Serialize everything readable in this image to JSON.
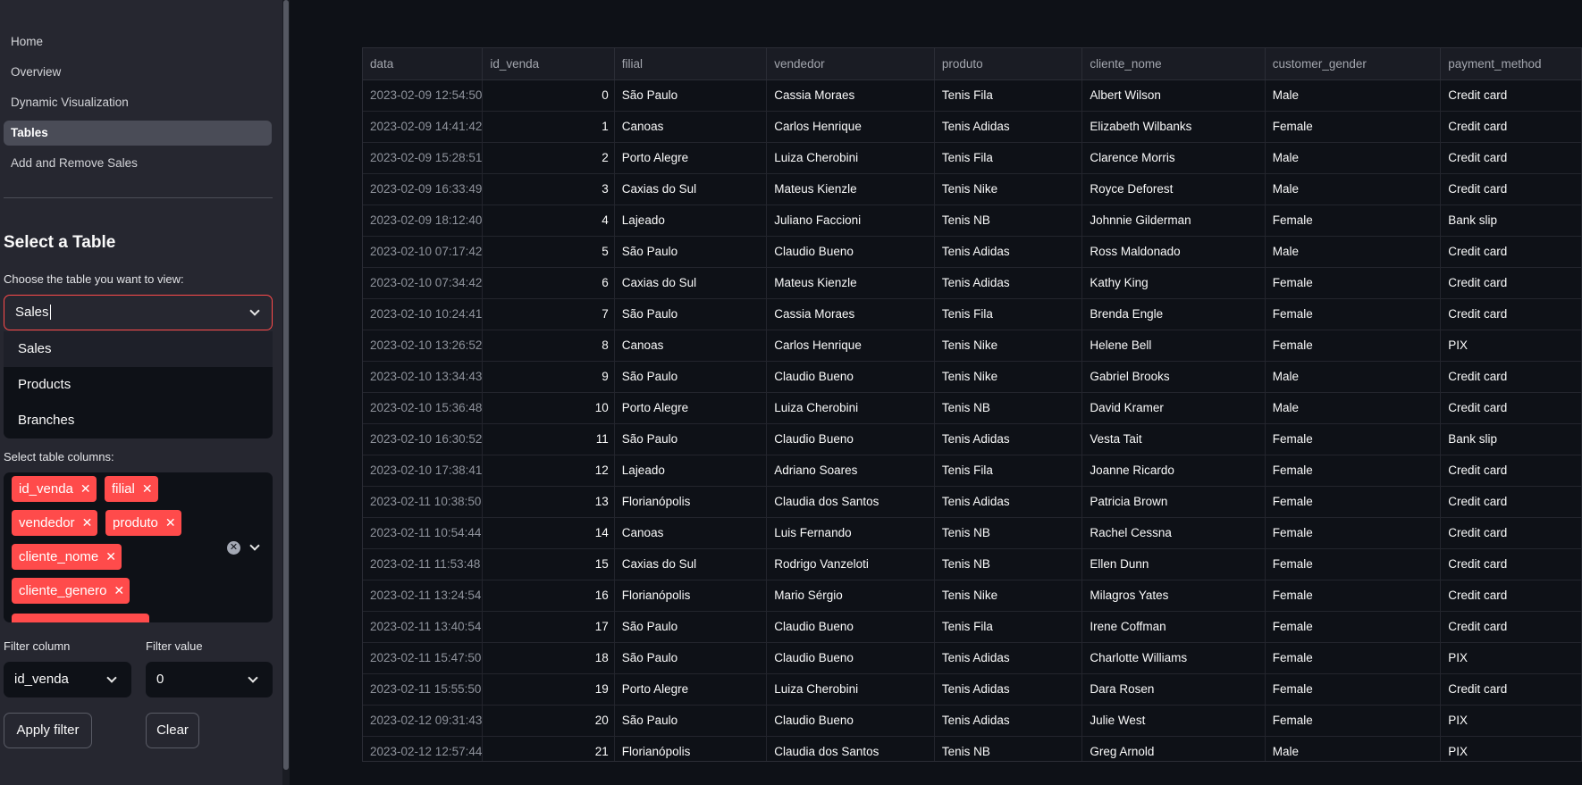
{
  "sidebar": {
    "nav": [
      "Home",
      "Overview",
      "Dynamic Visualization",
      "Tables",
      "Add and Remove Sales"
    ],
    "active_nav": "Tables",
    "section_title": "Select a Table",
    "table_select_label": "Choose the table you want to view:",
    "table_select_value": "Sales",
    "table_options": [
      "Sales",
      "Products",
      "Branches"
    ],
    "columns_label": "Select table columns:",
    "selected_columns": [
      "id_venda",
      "filial",
      "vendedor",
      "produto",
      "cliente_nome",
      "cliente_genero"
    ],
    "filter_column_label": "Filter column",
    "filter_column_value": "id_venda",
    "filter_value_label": "Filter value",
    "filter_value_value": "0",
    "apply_button": "Apply filter",
    "clear_button": "Clear"
  },
  "table": {
    "columns": [
      "data",
      "id_venda",
      "filial",
      "vendedor",
      "produto",
      "cliente_nome",
      "customer_gender",
      "payment_method"
    ],
    "rows": [
      [
        "2023-02-09 12:54:50",
        "0",
        "São Paulo",
        "Cassia Moraes",
        "Tenis Fila",
        "Albert Wilson",
        "Male",
        "Credit card"
      ],
      [
        "2023-02-09 14:41:42",
        "1",
        "Canoas",
        "Carlos Henrique",
        "Tenis Adidas",
        "Elizabeth Wilbanks",
        "Female",
        "Credit card"
      ],
      [
        "2023-02-09 15:28:51",
        "2",
        "Porto Alegre",
        "Luiza Cherobini",
        "Tenis Fila",
        "Clarence Morris",
        "Male",
        "Credit card"
      ],
      [
        "2023-02-09 16:33:49",
        "3",
        "Caxias do Sul",
        "Mateus Kienzle",
        "Tenis Nike",
        "Royce Deforest",
        "Male",
        "Credit card"
      ],
      [
        "2023-02-09 18:12:40",
        "4",
        "Lajeado",
        "Juliano Faccioni",
        "Tenis NB",
        "Johnnie Gilderman",
        "Female",
        "Bank slip"
      ],
      [
        "2023-02-10 07:17:42",
        "5",
        "São Paulo",
        "Claudio Bueno",
        "Tenis Adidas",
        "Ross Maldonado",
        "Male",
        "Credit card"
      ],
      [
        "2023-02-10 07:34:42",
        "6",
        "Caxias do Sul",
        "Mateus Kienzle",
        "Tenis Adidas",
        "Kathy King",
        "Female",
        "Credit card"
      ],
      [
        "2023-02-10 10:24:41",
        "7",
        "São Paulo",
        "Cassia Moraes",
        "Tenis Fila",
        "Brenda Engle",
        "Female",
        "Credit card"
      ],
      [
        "2023-02-10 13:26:52",
        "8",
        "Canoas",
        "Carlos Henrique",
        "Tenis Nike",
        "Helene Bell",
        "Female",
        "PIX"
      ],
      [
        "2023-02-10 13:34:43",
        "9",
        "São Paulo",
        "Claudio Bueno",
        "Tenis Nike",
        "Gabriel Brooks",
        "Male",
        "Credit card"
      ],
      [
        "2023-02-10 15:36:48",
        "10",
        "Porto Alegre",
        "Luiza Cherobini",
        "Tenis NB",
        "David Kramer",
        "Male",
        "Credit card"
      ],
      [
        "2023-02-10 16:30:52",
        "11",
        "São Paulo",
        "Claudio Bueno",
        "Tenis Adidas",
        "Vesta Tait",
        "Female",
        "Bank slip"
      ],
      [
        "2023-02-10 17:38:41",
        "12",
        "Lajeado",
        "Adriano Soares",
        "Tenis Fila",
        "Joanne Ricardo",
        "Female",
        "Credit card"
      ],
      [
        "2023-02-11 10:38:50",
        "13",
        "Florianópolis",
        "Claudia dos Santos",
        "Tenis Adidas",
        "Patricia Brown",
        "Female",
        "Credit card"
      ],
      [
        "2023-02-11 10:54:44",
        "14",
        "Canoas",
        "Luis Fernando",
        "Tenis NB",
        "Rachel Cessna",
        "Female",
        "Credit card"
      ],
      [
        "2023-02-11 11:53:48",
        "15",
        "Caxias do Sul",
        "Rodrigo Vanzeloti",
        "Tenis NB",
        "Ellen Dunn",
        "Female",
        "Credit card"
      ],
      [
        "2023-02-11 13:24:54",
        "16",
        "Florianópolis",
        "Mario Sérgio",
        "Tenis Nike",
        "Milagros Yates",
        "Female",
        "Credit card"
      ],
      [
        "2023-02-11 13:40:54",
        "17",
        "São Paulo",
        "Claudio Bueno",
        "Tenis Fila",
        "Irene Coffman",
        "Female",
        "Credit card"
      ],
      [
        "2023-02-11 15:47:50",
        "18",
        "São Paulo",
        "Claudio Bueno",
        "Tenis Adidas",
        "Charlotte Williams",
        "Female",
        "PIX"
      ],
      [
        "2023-02-11 15:55:50",
        "19",
        "Porto Alegre",
        "Luiza Cherobini",
        "Tenis Adidas",
        "Dara Rosen",
        "Female",
        "Credit card"
      ],
      [
        "2023-02-12 09:31:43",
        "20",
        "São Paulo",
        "Claudio Bueno",
        "Tenis Adidas",
        "Julie West",
        "Female",
        "PIX"
      ],
      [
        "2023-02-12 12:57:44",
        "21",
        "Florianópolis",
        "Claudia dos Santos",
        "Tenis NB",
        "Greg Arnold",
        "Male",
        "PIX"
      ]
    ]
  }
}
